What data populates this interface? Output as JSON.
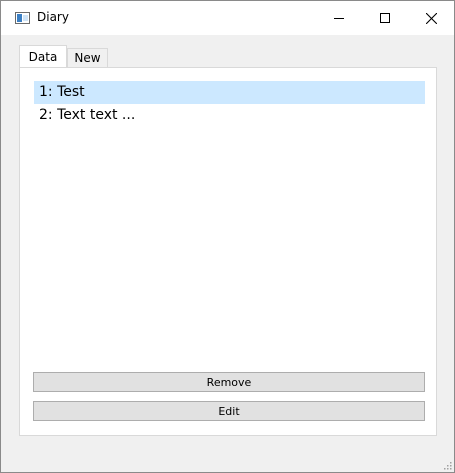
{
  "window": {
    "title": "Diary",
    "icon": "app-window-icon",
    "controls": [
      "minimize-icon",
      "maximize-icon",
      "close-icon"
    ]
  },
  "tabs": [
    {
      "label": "Data",
      "active": true
    },
    {
      "label": "New",
      "active": false
    }
  ],
  "list": {
    "items": [
      {
        "label": "1: Test",
        "selected": true
      },
      {
        "label": "2: Text text ...",
        "selected": false
      }
    ]
  },
  "buttons": {
    "remove_label": "Remove",
    "edit_label": "Edit"
  },
  "colors": {
    "selection": "#cce8ff",
    "button_face": "#e1e1e1"
  }
}
